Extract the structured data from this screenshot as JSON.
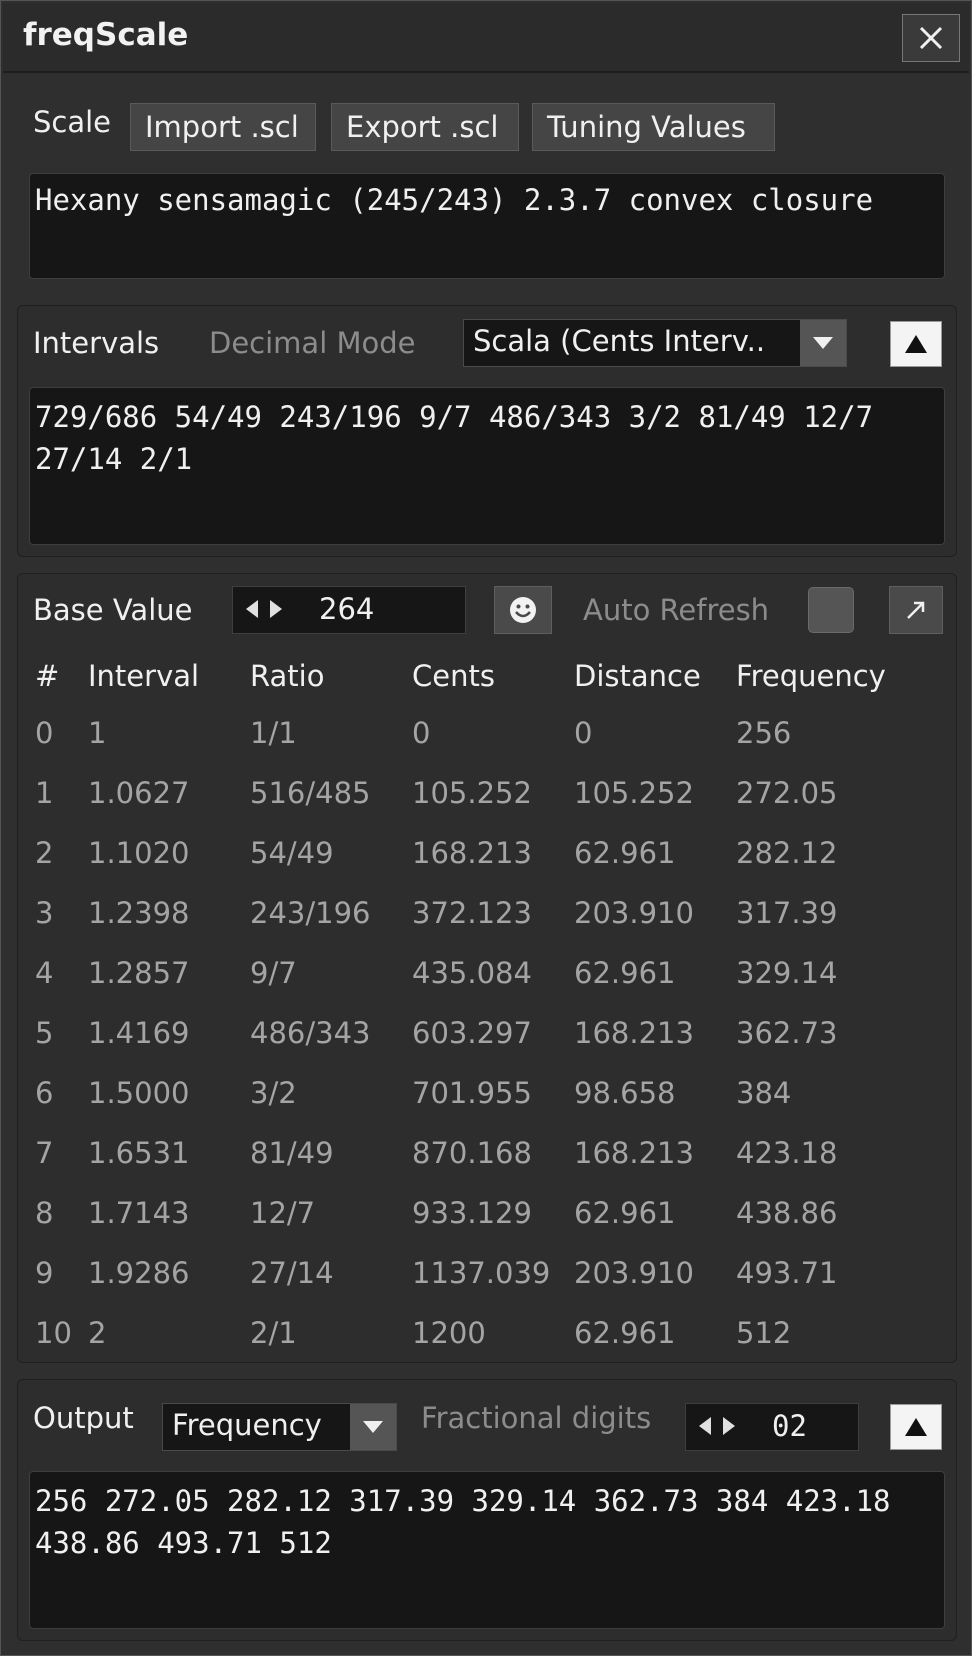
{
  "window": {
    "title": "freqScale"
  },
  "scale": {
    "label": "Scale",
    "import_label": "Import .scl",
    "export_label": "Export .scl",
    "tuning_label": "Tuning Values",
    "description": "Hexany sensamagic (245/243) 2.3.7 convex closure"
  },
  "intervals": {
    "label": "Intervals",
    "decimal_mode_label": "Decimal Mode",
    "mode_value": "Scala (Cents Interv..",
    "text": "729/686 54/49 243/196 9/7 486/343 3/2 81/49 12/7 27/14 2/1"
  },
  "base": {
    "label": "Base Value",
    "value": "264",
    "auto_refresh_label": "Auto Refresh"
  },
  "table": {
    "headers": [
      "#",
      "Interval",
      "Ratio",
      "Cents",
      "Distance",
      "Frequency"
    ],
    "rows": [
      [
        "0",
        "1",
        "1/1",
        "0",
        "0",
        "256"
      ],
      [
        "1",
        "1.0627",
        "516/485",
        "105.252",
        "105.252",
        "272.05"
      ],
      [
        "2",
        "1.1020",
        "54/49",
        "168.213",
        "62.961",
        "282.12"
      ],
      [
        "3",
        "1.2398",
        "243/196",
        "372.123",
        "203.910",
        "317.39"
      ],
      [
        "4",
        "1.2857",
        "9/7",
        "435.084",
        "62.961",
        "329.14"
      ],
      [
        "5",
        "1.4169",
        "486/343",
        "603.297",
        "168.213",
        "362.73"
      ],
      [
        "6",
        "1.5000",
        "3/2",
        "701.955",
        "98.658",
        "384"
      ],
      [
        "7",
        "1.6531",
        "81/49",
        "870.168",
        "168.213",
        "423.18"
      ],
      [
        "8",
        "1.7143",
        "12/7",
        "933.129",
        "62.961",
        "438.86"
      ],
      [
        "9",
        "1.9286",
        "27/14",
        "1137.039",
        "203.910",
        "493.71"
      ],
      [
        "10",
        "2",
        "2/1",
        "1200",
        "62.961",
        "512"
      ]
    ]
  },
  "output": {
    "label": "Output",
    "mode_value": "Frequency",
    "fractional_label": "Fractional digits",
    "fractional_value": "02",
    "text": "256 272.05 282.12 317.39 329.14 362.73 384 423.18 438.86 493.71 512"
  },
  "icons": {
    "close": "close-icon",
    "dropdown": "chevron-down-icon",
    "collapse": "triangle-up-icon",
    "smiley": "smiley-icon",
    "popout": "arrow-up-right-icon"
  },
  "colors": {
    "background": "#2f2f2f",
    "panel": "#2d2d2d",
    "text_area": "#161616",
    "dim_text": "#8c8c8c",
    "table_text": "#a4a4a4"
  }
}
